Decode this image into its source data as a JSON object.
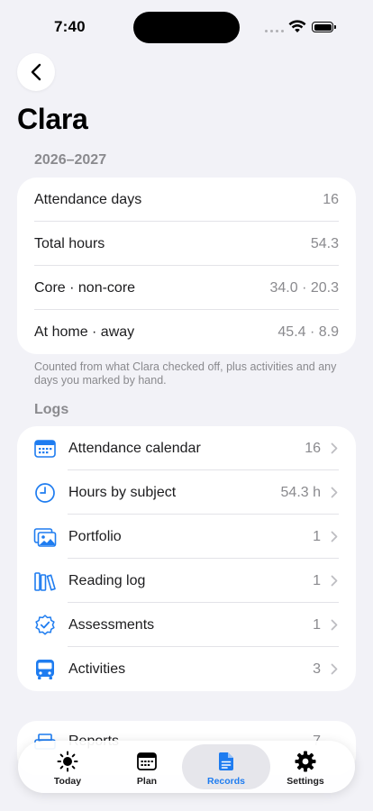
{
  "status": {
    "time": "7:40"
  },
  "page": {
    "title": "Clara"
  },
  "summary": {
    "year_label": "2026–2027",
    "rows": [
      {
        "label": "Attendance days",
        "value": "16"
      },
      {
        "label": "Total hours",
        "value": "54.3"
      },
      {
        "label": "Core · non-core",
        "value": "34.0 · 20.3"
      },
      {
        "label": "At home · away",
        "value": "45.4 · 8.9"
      }
    ],
    "footnote": "Counted from what Clara checked off, plus activities and any days you marked by hand."
  },
  "logs": {
    "section_label": "Logs",
    "items": [
      {
        "label": "Attendance calendar",
        "value": "16",
        "icon": "calendar-icon"
      },
      {
        "label": "Hours by subject",
        "value": "54.3 h",
        "icon": "clock-icon"
      },
      {
        "label": "Portfolio",
        "value": "1",
        "icon": "photos-icon"
      },
      {
        "label": "Reading log",
        "value": "1",
        "icon": "books-icon"
      },
      {
        "label": "Assessments",
        "value": "1",
        "icon": "checkmark-seal-icon"
      },
      {
        "label": "Activities",
        "value": "3",
        "icon": "bus-icon"
      }
    ]
  },
  "reports": {
    "label": "Reports",
    "value": "7"
  },
  "tabs": [
    {
      "label": "Today",
      "icon": "sun-icon",
      "active": false
    },
    {
      "label": "Plan",
      "icon": "calendar-grid-icon",
      "active": false
    },
    {
      "label": "Records",
      "icon": "document-icon",
      "active": true
    },
    {
      "label": "Settings",
      "icon": "gear-icon",
      "active": false
    }
  ],
  "colors": {
    "accent": "#1E7CF0",
    "background": "#F2F2F7",
    "secondary_text": "#8A8A8E"
  }
}
